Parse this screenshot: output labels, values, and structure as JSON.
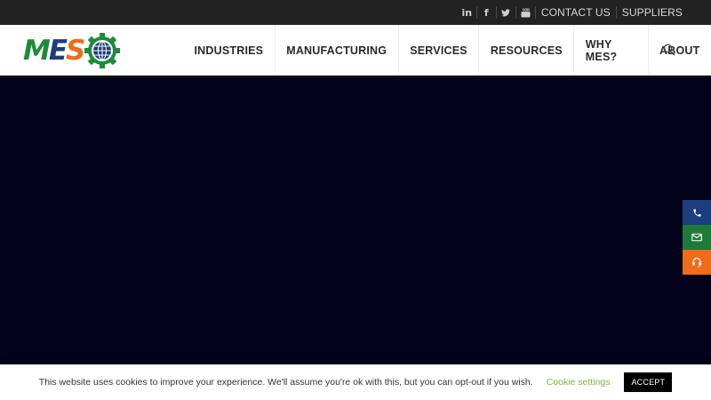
{
  "topbar": {
    "social": [
      {
        "icon": "linkedin-icon",
        "glyph": "in"
      },
      {
        "icon": "facebook-icon",
        "glyph": "f"
      },
      {
        "icon": "twitter-icon",
        "glyph": "t"
      },
      {
        "icon": "youtube-icon",
        "glyph": "▶"
      }
    ],
    "contact_label": "CONTACT US",
    "suppliers_label": "SUPPLIERS"
  },
  "logo": {
    "m": "M",
    "e": "E",
    "s": "S"
  },
  "nav": {
    "items": [
      "INDUSTRIES",
      "MANUFACTURING",
      "SERVICES",
      "RESOURCES",
      "WHY MES?",
      "ABOUT"
    ]
  },
  "sidetabs": [
    {
      "icon": "phone-icon",
      "color": "#1c3e7c"
    },
    {
      "icon": "envelope-icon",
      "color": "#1f7a3a"
    },
    {
      "icon": "support-icon",
      "color": "#ef6c1a"
    }
  ],
  "cookie": {
    "message": "This website uses cookies to improve your experience. We'll assume you're ok with this, but you can opt-out if you wish.",
    "settings_label": "Cookie settings",
    "accept_label": "ACCEPT"
  },
  "colors": {
    "hero": "#02021a",
    "brand_green": "#1f8a3a",
    "brand_blue": "#1c3e7c",
    "brand_orange": "#ef6c1a"
  }
}
